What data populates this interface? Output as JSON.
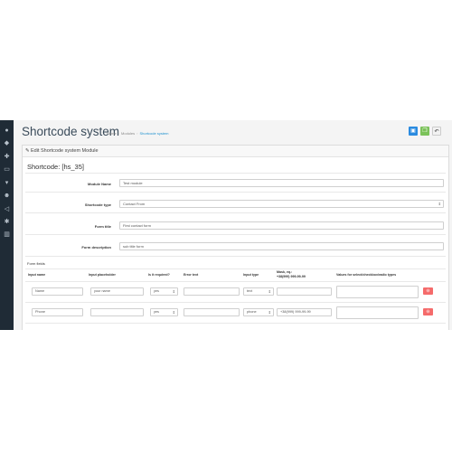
{
  "header": {
    "title": "Shortcode system",
    "breadcrumbs": [
      "Home",
      "Modules",
      "Shortcode system"
    ]
  },
  "panel": {
    "heading": "Edit Shortcode system Module",
    "shortcode": "Shortcode: [hs_35]"
  },
  "form": {
    "module_name": {
      "label": "Module Name",
      "value": "Test module"
    },
    "shortcode_type": {
      "label": "Shortcode type",
      "value": "Contact From"
    },
    "form_title": {
      "label": "Form title",
      "value": "First contact form"
    },
    "form_description": {
      "label": "Form description",
      "value": "sub title form"
    }
  },
  "form_fields": {
    "label": "Form fields",
    "columns": [
      "Input name",
      "Input placeholder",
      "Is it required?",
      "Error text",
      "Input type",
      "Mask, eq.:",
      "+38(999) 999-99-99",
      "Values for select/checkbox/radio types"
    ],
    "rows": [
      {
        "name": "Name",
        "placeholder": "your name",
        "required": "yes",
        "error": "",
        "type": "text",
        "mask": "",
        "values": ""
      },
      {
        "name": "Phone",
        "placeholder": "",
        "required": "yes",
        "error": "",
        "type": "phone",
        "mask": "+38(999) 999-99-99",
        "values": ""
      }
    ]
  },
  "colors": {
    "sidebar": "#1f2b36",
    "save": "#2a8be0",
    "copy": "#7bc25a",
    "delete": "#f56b6b",
    "link": "#1e91cf"
  },
  "icons": {
    "sidebar": [
      "dashboard-icon",
      "tag-icon",
      "puzzle-icon",
      "desktop-icon",
      "cart-icon",
      "user-icon",
      "share-icon",
      "gear-icon",
      "chart-icon"
    ],
    "toolbar": [
      "save-icon",
      "copy-icon",
      "back-icon"
    ]
  }
}
